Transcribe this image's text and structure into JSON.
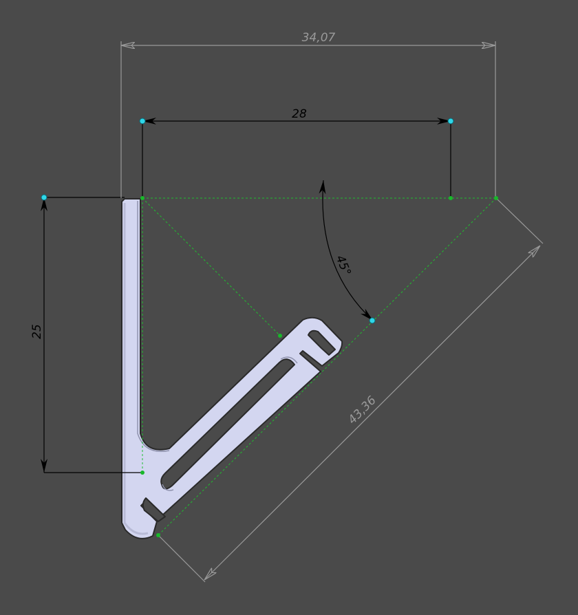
{
  "drawing": {
    "background": "#4a4a4a",
    "part_fill": "#d3d6f0",
    "part_edge": "#2a2a2a",
    "driving_dim_color": "#000000",
    "driven_dim_color": "#9a9a9a",
    "construction_color": "#1fbf2f",
    "point_color": "#18b82a",
    "endpoint_color": "#2fd7e8"
  },
  "dimensions": {
    "overall_width": "34,07",
    "inner_width": "28",
    "height": "25",
    "diagonal_length": "43,36",
    "angle": "45°"
  }
}
